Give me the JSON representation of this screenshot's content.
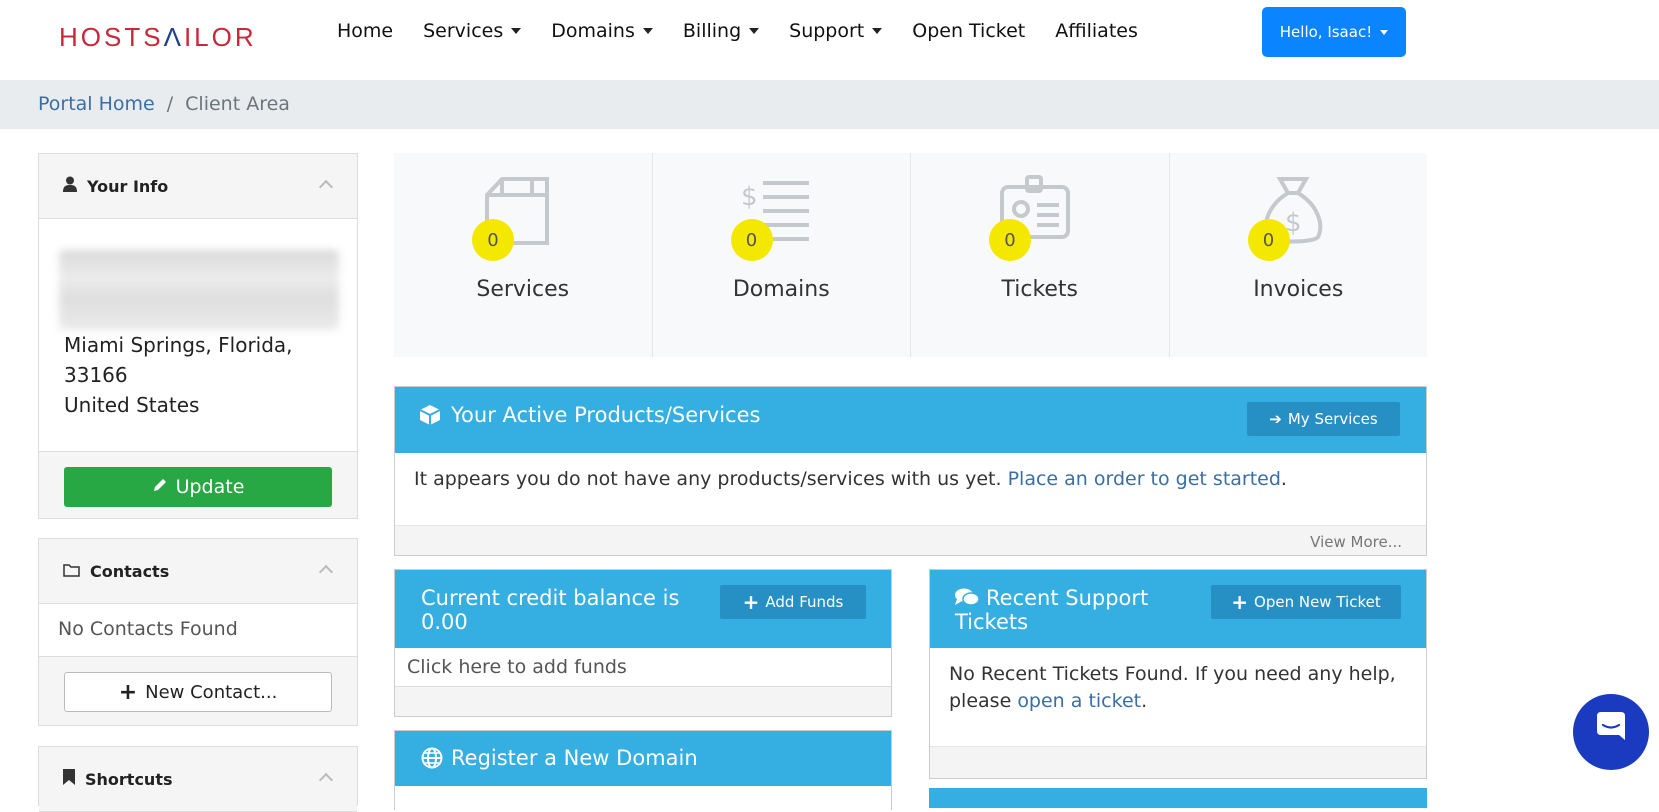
{
  "brand": {
    "logo_part1": "HOSTS",
    "logo_sail": "Λ",
    "logo_part2": "ILOR"
  },
  "nav": {
    "home": "Home",
    "services": "Services",
    "domains": "Domains",
    "billing": "Billing",
    "support": "Support",
    "open_ticket": "Open Ticket",
    "affiliates": "Affiliates",
    "user_greeting": "Hello, Isaac!"
  },
  "breadcrumb": {
    "home": "Portal Home",
    "separator": "/",
    "current": "Client Area"
  },
  "sidebar": {
    "your_info": {
      "title": "Your Info",
      "address_line1": "Miami Springs, Florida,",
      "address_line2": "33166",
      "address_line3": "United States",
      "update_label": "Update"
    },
    "contacts": {
      "title": "Contacts",
      "empty_text": "No Contacts Found",
      "new_contact_label": "New Contact..."
    },
    "shortcuts": {
      "title": "Shortcuts"
    }
  },
  "stats": [
    {
      "label": "Services",
      "count": "0"
    },
    {
      "label": "Domains",
      "count": "0"
    },
    {
      "label": "Tickets",
      "count": "0"
    },
    {
      "label": "Invoices",
      "count": "0"
    }
  ],
  "active_products": {
    "title": "Your Active Products/Services",
    "button": "My Services",
    "body_text": "It appears you do not have any products/services with us yet.",
    "body_link": "Place an order to get started",
    "body_end": ".",
    "footer_link": "View More..."
  },
  "credit": {
    "title": "Current credit balance is 0.00",
    "button": "Add Funds",
    "body_text": "Click here to add funds"
  },
  "support_tickets": {
    "title": "Recent Support Tickets",
    "button": "Open New Ticket",
    "body_text": "No Recent Tickets Found. If you need any help, please",
    "body_link": "open a ticket",
    "body_end": "."
  },
  "register_domain": {
    "title": "Register a New Domain"
  },
  "colors": {
    "primary_blue": "#0a84ff",
    "panel_blue": "#35aee2",
    "panel_button": "#2690c4",
    "green": "#28a745",
    "badge_yellow": "#f5e800",
    "link": "#3a6ea5",
    "chat": "#1a3bbf"
  },
  "icons": {
    "your_info": "user-icon",
    "contacts": "folder-icon",
    "shortcuts": "bookmark-icon",
    "services_tile": "box-icon",
    "domains_tile": "dollar-list-icon",
    "tickets_tile": "id-badge-icon",
    "invoices_tile": "money-bag-icon",
    "products_panel": "cube-icon",
    "support_panel": "comments-icon",
    "domain_panel": "globe-icon",
    "chat": "chat-bubble-icon"
  }
}
